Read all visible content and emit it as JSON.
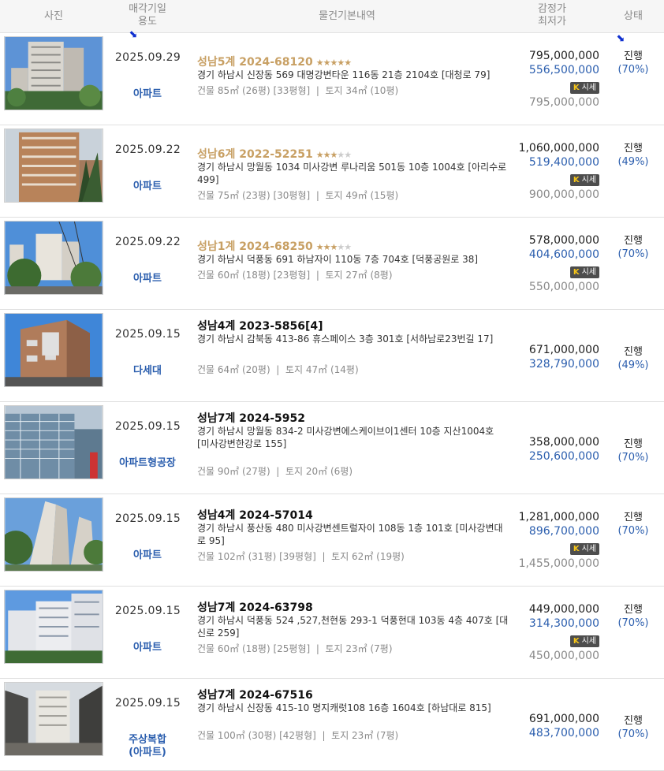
{
  "header": {
    "photo": "사진",
    "date": "매각기일",
    "usage": "용도",
    "info": "물건기본내역",
    "appraisal": "감정가",
    "minimum": "최저가",
    "status": "상태"
  },
  "badge_label": "시세",
  "badge_logo": "K",
  "separator": "|",
  "rows": [
    {
      "date": "2025.09.29",
      "usage": "아파트",
      "case": "성남5계 2024-68120",
      "gold": true,
      "stars": 5,
      "address": "경기 하남시 신장동 569 대명강변타운 116동 21층 2104호 [대청로 79]",
      "building": "건물 85㎡ (26평) [33평형]",
      "land": "토지 34㎡ (10평)",
      "appraisal": "795,000,000",
      "minimum": "556,500,000",
      "market": "795,000,000",
      "status": "진행",
      "percent": "(70%)",
      "photo": "apt-tall"
    },
    {
      "date": "2025.09.22",
      "usage": "아파트",
      "case": "성남6계 2022-52251",
      "gold": true,
      "stars": 3,
      "address": "경기 하남시 망월동 1034 미사강변 루나리움 501동 10층 1004호 [아리수로 499]",
      "building": "건물 75㎡ (23평) [30평형]",
      "land": "토지 49㎡ (15평)",
      "appraisal": "1,060,000,000",
      "minimum": "519,400,000",
      "market": "900,000,000",
      "status": "진행",
      "percent": "(49%)",
      "photo": "apt-brown"
    },
    {
      "date": "2025.09.22",
      "usage": "아파트",
      "case": "성남1계 2024-68250",
      "gold": true,
      "stars": 2.5,
      "address": "경기 하남시 덕풍동 691 하남자이 110동 7층 704호 [덕풍공원로 38]",
      "building": "건물 60㎡ (18평) [23평형]",
      "land": "토지 27㎡ (8평)",
      "appraisal": "578,000,000",
      "minimum": "404,600,000",
      "market": "550,000,000",
      "status": "진행",
      "percent": "(70%)",
      "photo": "apt-trees"
    },
    {
      "date": "2025.09.15",
      "usage": "다세대",
      "case": "성남4계 2023-5856[4]",
      "gold": false,
      "stars": 0,
      "address": "경기 하남시 감북동 413-86 휴스페이스 3층 301호 [서하남로23번길 17]",
      "building": "건물 64㎡ (20평)",
      "land": "토지 47㎡ (14평)",
      "appraisal": "671,000,000",
      "minimum": "328,790,000",
      "market": "",
      "status": "진행",
      "percent": "(49%)",
      "photo": "villa"
    },
    {
      "date": "2025.09.15",
      "usage": "아파트형공장",
      "case": "성남7계 2024-5952",
      "gold": false,
      "stars": 0,
      "address": "경기 하남시 망월동 834-2 미사강변에스케이브이1센터 10층 지산1004호 [미사강변한강로 155]",
      "building": "건물 90㎡ (27평)",
      "land": "토지 20㎡ (6평)",
      "appraisal": "358,000,000",
      "minimum": "250,600,000",
      "market": "",
      "status": "진행",
      "percent": "(70%)",
      "photo": "office"
    },
    {
      "date": "2025.09.15",
      "usage": "아파트",
      "case": "성남4계 2024-57014",
      "gold": false,
      "stars": 0,
      "address": "경기 하남시 풍산동 480 미사강변센트럴자이 108동 1층 101호 [미사강변대로 95]",
      "building": "건물 102㎡ (31평) [39평형]",
      "land": "토지 62㎡ (19평)",
      "appraisal": "1,281,000,000",
      "minimum": "896,700,000",
      "market": "1,455,000,000",
      "status": "진행",
      "percent": "(70%)",
      "photo": "apt-tall2"
    },
    {
      "date": "2025.09.15",
      "usage": "아파트",
      "case": "성남7계 2024-63798",
      "gold": false,
      "stars": 0,
      "address": "경기 하남시 덕풍동 524 ,527,천현동 293-1 덕풍현대 103동 4층 407호 [대신로 259]",
      "building": "건물 60㎡ (18평) [25평형]",
      "land": "토지 23㎡ (7평)",
      "appraisal": "449,000,000",
      "minimum": "314,300,000",
      "market": "450,000,000",
      "status": "진행",
      "percent": "(70%)",
      "photo": "apt-white"
    },
    {
      "date": "2025.09.15",
      "usage": "주상복합\n(아파트)",
      "case": "성남7계 2024-67516",
      "gold": false,
      "stars": 0,
      "address": "경기 하남시 신장동 415-10 명지캐럿108 16층 1604호 [하남대로 815]",
      "building": "건물 100㎡ (30평) [42평형]",
      "land": "토지 23㎡ (7평)",
      "appraisal": "691,000,000",
      "minimum": "483,700,000",
      "market": "",
      "status": "진행",
      "percent": "(70%)",
      "photo": "mixed"
    }
  ]
}
